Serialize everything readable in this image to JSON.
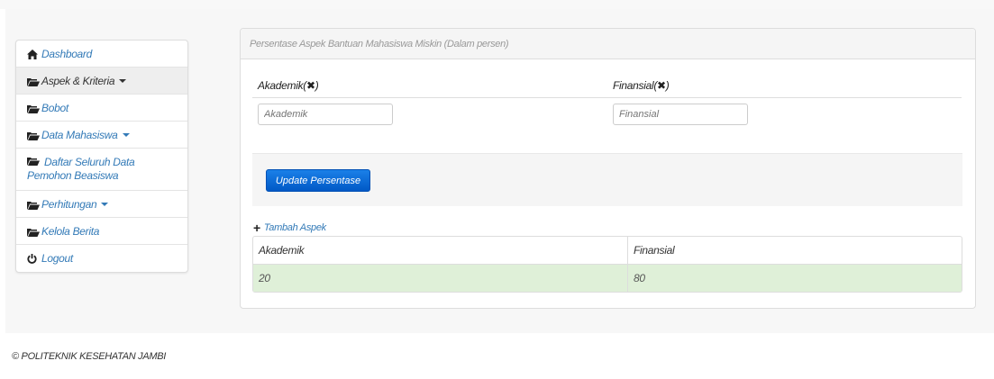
{
  "sidebar": {
    "items": [
      {
        "label": "Dashboard",
        "icon": "home-icon"
      },
      {
        "label": "Aspek & Kriteria",
        "icon": "folder-open-icon",
        "dropdown": true
      },
      {
        "label": "Bobot",
        "icon": "folder-open-icon"
      },
      {
        "label": "Data Mahasiswa",
        "icon": "folder-open-icon",
        "dropdown": true
      },
      {
        "label": "Daftar Seluruh Data Pemohon Beasiswa",
        "icon": "folder-open-icon"
      },
      {
        "label": "Perhitungan",
        "icon": "folder-open-icon",
        "dropdown": true
      },
      {
        "label": "Kelola Berita",
        "icon": "folder-open-icon"
      },
      {
        "label": "Logout",
        "icon": "power-icon"
      }
    ]
  },
  "panel": {
    "heading": "Persentase Aspek Bantuan Mahasiswa Miskin (Dalam persen)",
    "fields": [
      {
        "label": "Akademik(",
        "mark": "✖",
        "close": ")",
        "placeholder": "Akademik"
      },
      {
        "label": "Finansial(",
        "mark": "✖",
        "close": ")",
        "placeholder": "Finansial"
      }
    ],
    "update_button": "Update Persentase",
    "add_link": "Tambah Aspek",
    "add_icon": "+",
    "table": {
      "headers": [
        "Akademik",
        "Finansial"
      ],
      "rows": [
        [
          "20",
          "80"
        ]
      ]
    }
  },
  "footer": {
    "text": "© POLITEKNIK KESEHATAN JAMBI"
  },
  "colors": {
    "link": "#337ab7",
    "primary_button": "#0a6ad8",
    "success_row": "#dff0d8"
  }
}
